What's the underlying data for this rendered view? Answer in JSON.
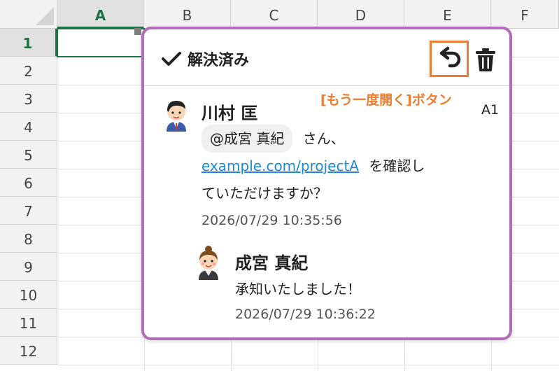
{
  "spreadsheet": {
    "columns": [
      "A",
      "B",
      "C",
      "D",
      "E",
      "F"
    ],
    "rows": [
      "1",
      "2",
      "3",
      "4",
      "5",
      "6",
      "7",
      "8",
      "9",
      "10",
      "11",
      "12"
    ],
    "selected_column": "A",
    "selected_row": "1"
  },
  "comment": {
    "resolved_label": "解決済み",
    "reopen_annotation": "[もう一度開く]ボタン",
    "cell_ref": "A1",
    "thread": [
      {
        "author": "川村 匡",
        "mention": "@成宮 真紀",
        "text_after_mention": "さん、",
        "link": "example.com/projectA",
        "text_after_link": "を確認し",
        "text_line3": "ていただけますか？",
        "timestamp": "2026/07/29 10:35:56"
      },
      {
        "author": "成宮 真紀",
        "text": "承知いたしました！",
        "timestamp": "2026/07/29 10:36:22"
      }
    ]
  },
  "colors": {
    "accent_green": "#217346",
    "panel_border": "#b36db8",
    "annotation_orange": "#ed7d31",
    "link_blue": "#1b8cd2"
  }
}
